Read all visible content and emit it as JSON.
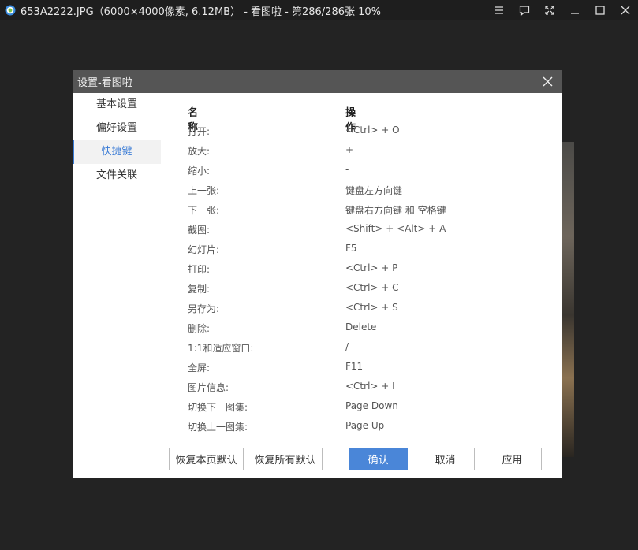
{
  "window": {
    "title": "653A2222.JPG（6000×4000像素, 6.12MB） - 看图啦 - 第286/286张 10%",
    "icons": [
      "menu-icon",
      "comment-icon",
      "fullscreen-icon",
      "minimize-icon",
      "maximize-icon",
      "close-icon"
    ]
  },
  "dialog": {
    "title": "设置-看图啦",
    "nav": [
      "基本设置",
      "偏好设置",
      "快捷键",
      "文件关联"
    ],
    "active_nav": "快捷键",
    "headers": {
      "name": "名称",
      "action": "操作"
    },
    "rows": [
      {
        "name": "打开:",
        "key": "<Ctrl> + O"
      },
      {
        "name": "放大:",
        "key": "+"
      },
      {
        "name": "缩小:",
        "key": "-"
      },
      {
        "name": "上一张:",
        "key": "键盘左方向键"
      },
      {
        "name": "下一张:",
        "key": "键盘右方向键 和 空格键"
      },
      {
        "name": "截图:",
        "key": "<Shift> + <Alt> + A"
      },
      {
        "name": "幻灯片:",
        "key": "F5"
      },
      {
        "name": "打印:",
        "key": "<Ctrl> + P"
      },
      {
        "name": "复制:",
        "key": "<Ctrl> + C"
      },
      {
        "name": "另存为:",
        "key": "<Ctrl> + S"
      },
      {
        "name": "删除:",
        "key": "Delete"
      },
      {
        "name": "1:1和适应窗口:",
        "key": "/"
      },
      {
        "name": "全屏:",
        "key": "F11"
      },
      {
        "name": "图片信息:",
        "key": "<Ctrl> + I"
      },
      {
        "name": "切换下一图集:",
        "key": "Page Down"
      },
      {
        "name": "切换上一图集:",
        "key": "Page Up"
      }
    ],
    "buttons": {
      "restore_page": "恢复本页默认",
      "restore_all": "恢复所有默认",
      "ok": "确认",
      "cancel": "取消",
      "apply": "应用"
    }
  },
  "colors": {
    "accent": "#4a86d8",
    "background": "#232323",
    "titlebar": "#1e1e1e",
    "dialog_title": "#555555"
  }
}
